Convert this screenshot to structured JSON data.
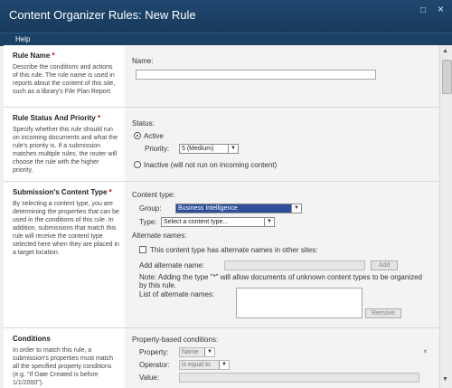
{
  "window": {
    "title": "Content Organizer Rules: New Rule",
    "minimize_glyph": "□",
    "close_glyph": "×"
  },
  "menu": {
    "help": "Help"
  },
  "rule_name": {
    "title": "Rule Name",
    "required": "*",
    "description": "Describe the conditions and actions of this rule. The rule name is used in reports about the content of this site, such as a library's File Plan Report.",
    "name_label": "Name:",
    "name_value": ""
  },
  "status": {
    "title": "Rule Status And Priority",
    "required": "*",
    "description": "Specify whether this rule should run on incoming documents and what the rule's priority is. If a submission matches multiple rules, the router will choose the rule with the higher priority.",
    "status_label": "Status:",
    "active_label": "Active",
    "priority_label": "Priority:",
    "priority_value": "5 (Medium)",
    "inactive_label": "Inactive (will not run on incoming content)"
  },
  "content_type": {
    "title": "Submission's Content Type",
    "required": "*",
    "description": "By selecting a content type, you are determining the properties that can be used in the conditions of this rule. In addition, submissions that match this rule will receive the content type selected here when they are placed in a target location.",
    "content_type_label": "Content type:",
    "group_label": "Group:",
    "group_value": "Business Intelligence",
    "type_label": "Type:",
    "type_value": "Select a content type...",
    "alternate_names_label": "Alternate names:",
    "alternate_checkbox_label": "This content type has alternate names in other sites:",
    "add_alternate_label": "Add alternate name:",
    "add_button": "Add",
    "note": "Note: Adding the type \"*\" will allow documents of unknown content types to be organized by this rule.",
    "list_label": "List of alternate names:",
    "remove_button": "Remove"
  },
  "conditions": {
    "title": "Conditions",
    "description": "In order to match this rule, a submission's properties must match all the specified property conditions (e.g. \"If Date Created is before 1/1/2000\").",
    "property_based_label": "Property-based conditions:",
    "property_label": "Property:",
    "property_value": "Name",
    "operator_label": "Operator:",
    "operator_value": "is equal to",
    "value_label": "Value:",
    "remove_glyph": "×"
  },
  "scroll": {
    "up": "▲",
    "down": "▼"
  }
}
